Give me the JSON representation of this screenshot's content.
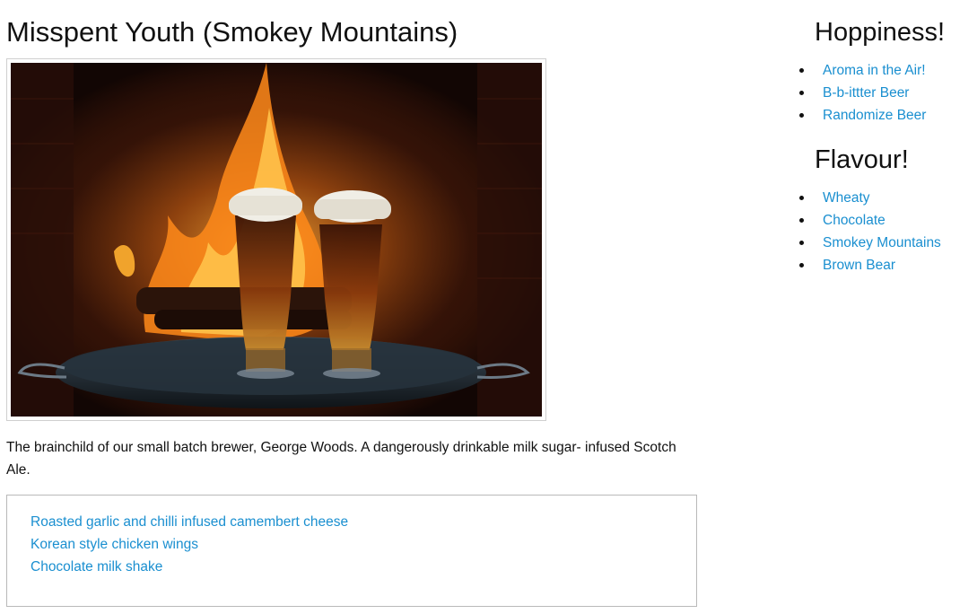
{
  "main": {
    "title": "Misspent Youth (Smokey Mountains)",
    "description": "The brainchild of our small batch brewer, George Woods. A dangerously drinkable milk sugar- infused Scotch Ale.",
    "pairings": [
      "Roasted garlic and chilli infused camembert cheese",
      "Korean style chicken wings",
      "Chocolate milk shake"
    ]
  },
  "sidebar": {
    "hoppiness": {
      "title": "Hoppiness!",
      "items": [
        "Aroma in the Air!",
        "B-b-ittter Beer",
        "Randomize Beer"
      ]
    },
    "flavour": {
      "title": "Flavour!",
      "items": [
        "Wheaty",
        "Chocolate",
        "Smokey Mountains",
        "Brown Bear"
      ]
    }
  },
  "colors": {
    "link": "#1a8fd0",
    "text": "#111111",
    "border": "#b9b9b9"
  }
}
